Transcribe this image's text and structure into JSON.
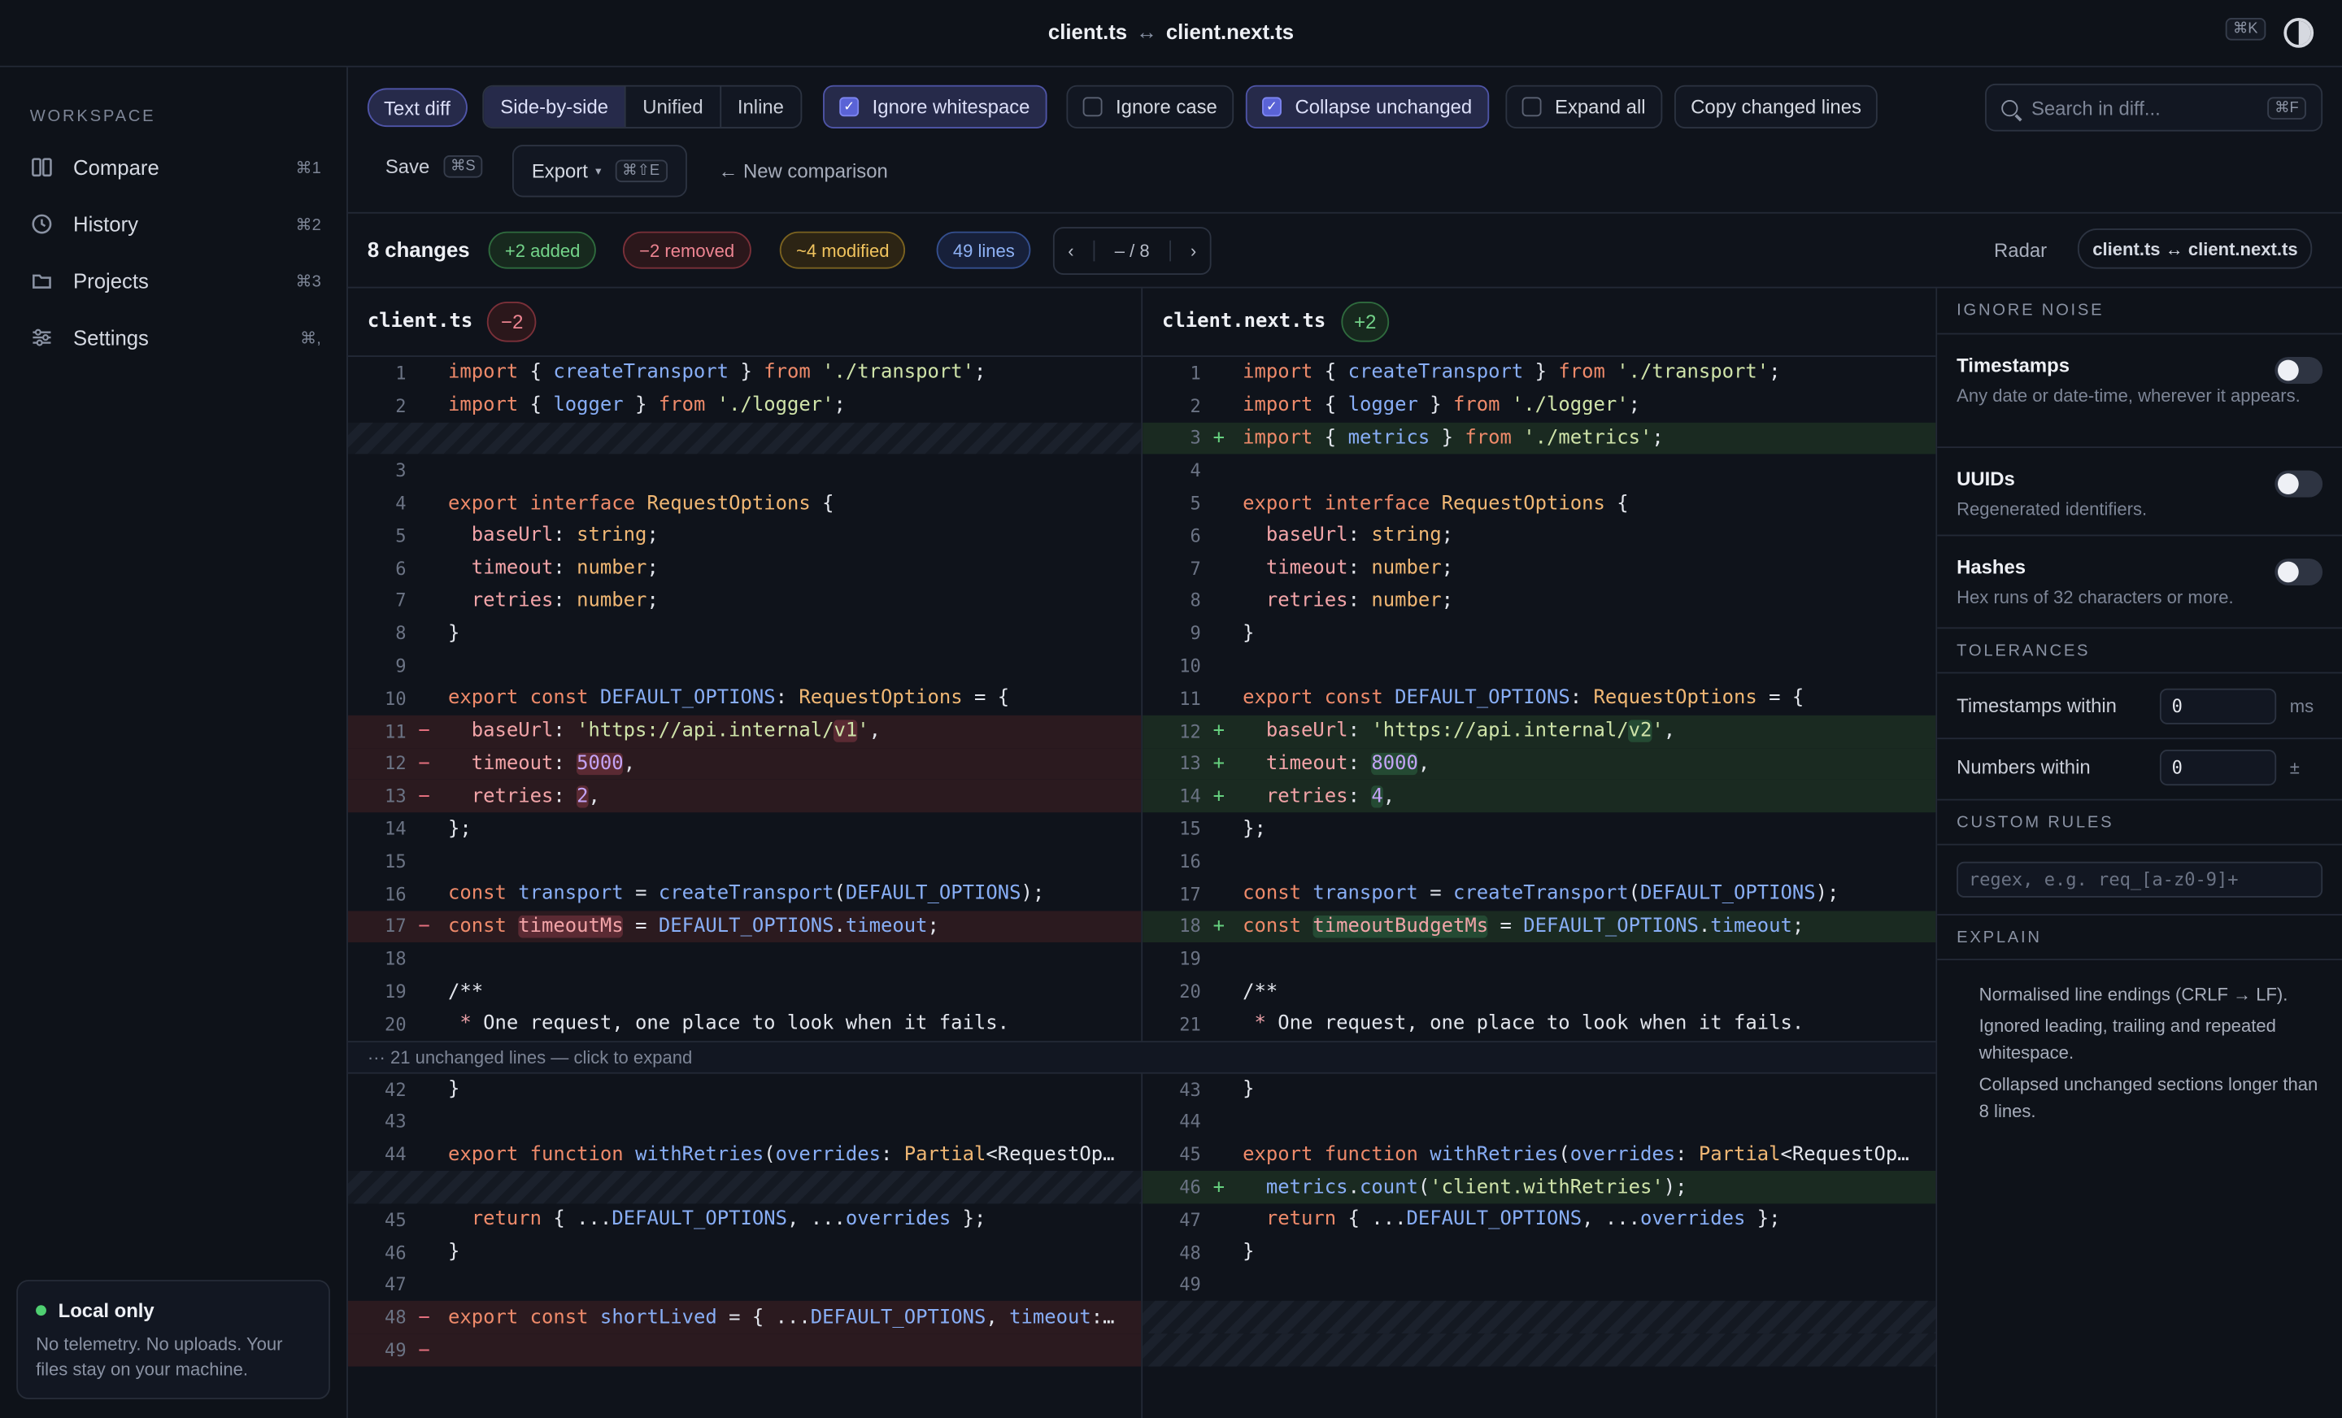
{
  "title": {
    "left_file": "client.ts",
    "arrow": "↔",
    "right_file": "client.next.ts",
    "kbd": "⌘K"
  },
  "sidebar": {
    "section": "WORKSPACE",
    "items": [
      {
        "label": "Compare",
        "shortcut": "⌘1",
        "icon": "columns-icon"
      },
      {
        "label": "History",
        "shortcut": "⌘2",
        "icon": "clock-icon"
      },
      {
        "label": "Projects",
        "shortcut": "⌘3",
        "icon": "folder-icon"
      },
      {
        "label": "Settings",
        "shortcut": "⌘,",
        "icon": "sliders-icon"
      }
    ],
    "local": {
      "title": "Local only",
      "text": "No telemetry. No uploads. Your files stay on your machine."
    }
  },
  "toolbar": {
    "mode": "Text diff",
    "views": [
      "Side-by-side",
      "Unified",
      "Inline"
    ],
    "active_view": "Side-by-side",
    "options": [
      {
        "label": "Ignore whitespace",
        "checked": true
      },
      {
        "label": "Ignore case",
        "checked": false
      },
      {
        "label": "Collapse unchanged",
        "checked": true
      },
      {
        "label": "Expand all",
        "checked": false
      }
    ],
    "copy": "Copy changed lines",
    "search_placeholder": "Search in diff...",
    "search_kbd": "⌘F",
    "save": "Save",
    "save_kbd": "⌘S",
    "export": "Export",
    "export_kbd": "⌘⇧E",
    "new": "← New comparison"
  },
  "summary": {
    "changes": "8 changes",
    "added": "+2 added",
    "removed": "−2 removed",
    "modified": "~4 modified",
    "lines": "49 lines",
    "pager": "– / 8",
    "radar": "Radar",
    "path": "client.ts ↔ client.next.ts"
  },
  "left": {
    "file": "client.ts",
    "count": "−2"
  },
  "right": {
    "file": "client.next.ts",
    "count": "+2"
  },
  "collapsed": "··· 21 unchanged lines — click to expand",
  "panel": {
    "ignore_noise": "IGNORE NOISE",
    "noise": [
      {
        "title": "Timestamps",
        "desc": "Any date or date-time, wherever it appears.",
        "on": false
      },
      {
        "title": "UUIDs",
        "desc": "Regenerated identifiers.",
        "on": false
      },
      {
        "title": "Hashes",
        "desc": "Hex runs of 32 characters or more.",
        "on": false
      }
    ],
    "tolerances": "TOLERANCES",
    "tol": [
      {
        "label": "Timestamps within",
        "value": "0",
        "unit": "ms"
      },
      {
        "label": "Numbers within",
        "value": "0",
        "unit": "±"
      }
    ],
    "custom_rules": "CUSTOM RULES",
    "rule_placeholder": "regex, e.g. req_[a-z0-9]+",
    "explain": "EXPLAIN",
    "explain_items": [
      "Normalised line endings (CRLF → LF).",
      "Ignored leading, trailing and repeated whitespace.",
      "Collapsed unchanged sections longer than 8 lines."
    ]
  },
  "code": {
    "left": [
      {
        "n": "1",
        "t": "",
        "c": "import { createTransport } from './transport';"
      },
      {
        "n": "2",
        "t": "",
        "c": "import { logger } from './logger';"
      },
      {
        "n": "",
        "t": "blank",
        "c": ""
      },
      {
        "n": "3",
        "t": "",
        "c": ""
      },
      {
        "n": "4",
        "t": "",
        "c": "export interface RequestOptions {"
      },
      {
        "n": "5",
        "t": "",
        "c": "  baseUrl: string;"
      },
      {
        "n": "6",
        "t": "",
        "c": "  timeout: number;"
      },
      {
        "n": "7",
        "t": "",
        "c": "  retries: number;"
      },
      {
        "n": "8",
        "t": "",
        "c": "}"
      },
      {
        "n": "9",
        "t": "",
        "c": ""
      },
      {
        "n": "10",
        "t": "",
        "c": "export const DEFAULT_OPTIONS: RequestOptions = {"
      },
      {
        "n": "11",
        "t": "del",
        "c": "  baseUrl: 'https://api.internal/v1',"
      },
      {
        "n": "12",
        "t": "del",
        "c": "  timeout: 5000,"
      },
      {
        "n": "13",
        "t": "del",
        "c": "  retries: 2,"
      },
      {
        "n": "14",
        "t": "",
        "c": "};"
      },
      {
        "n": "15",
        "t": "",
        "c": ""
      },
      {
        "n": "16",
        "t": "",
        "c": "const transport = createTransport(DEFAULT_OPTIONS);"
      },
      {
        "n": "17",
        "t": "del",
        "c": "const timeoutMs = DEFAULT_OPTIONS.timeout;"
      },
      {
        "n": "18",
        "t": "",
        "c": ""
      },
      {
        "n": "19",
        "t": "",
        "c": "/**"
      },
      {
        "n": "20",
        "t": "",
        "c": " * One request, one place to look when it fails."
      },
      {
        "n": "",
        "t": "gap",
        "c": ""
      },
      {
        "n": "42",
        "t": "",
        "c": "}"
      },
      {
        "n": "43",
        "t": "",
        "c": ""
      },
      {
        "n": "44",
        "t": "",
        "c": "export function withRetries(overrides: Partial<RequestOp…"
      },
      {
        "n": "",
        "t": "blank",
        "c": ""
      },
      {
        "n": "45",
        "t": "",
        "c": "  return { ...DEFAULT_OPTIONS, ...overrides };"
      },
      {
        "n": "46",
        "t": "",
        "c": "}"
      },
      {
        "n": "47",
        "t": "",
        "c": ""
      },
      {
        "n": "48",
        "t": "del",
        "c": "export const shortLived = { ...DEFAULT_OPTIONS, timeout:…"
      },
      {
        "n": "49",
        "t": "del",
        "c": ""
      }
    ],
    "right": [
      {
        "n": "1",
        "t": "",
        "c": "import { createTransport } from './transport';"
      },
      {
        "n": "2",
        "t": "",
        "c": "import { logger } from './logger';"
      },
      {
        "n": "3",
        "t": "add",
        "c": "import { metrics } from './metrics';"
      },
      {
        "n": "4",
        "t": "",
        "c": ""
      },
      {
        "n": "5",
        "t": "",
        "c": "export interface RequestOptions {"
      },
      {
        "n": "6",
        "t": "",
        "c": "  baseUrl: string;"
      },
      {
        "n": "7",
        "t": "",
        "c": "  timeout: number;"
      },
      {
        "n": "8",
        "t": "",
        "c": "  retries: number;"
      },
      {
        "n": "9",
        "t": "",
        "c": "}"
      },
      {
        "n": "10",
        "t": "",
        "c": ""
      },
      {
        "n": "11",
        "t": "",
        "c": "export const DEFAULT_OPTIONS: RequestOptions = {"
      },
      {
        "n": "12",
        "t": "add",
        "c": "  baseUrl: 'https://api.internal/v2',"
      },
      {
        "n": "13",
        "t": "add",
        "c": "  timeout: 8000,"
      },
      {
        "n": "14",
        "t": "add",
        "c": "  retries: 4,"
      },
      {
        "n": "15",
        "t": "",
        "c": "};"
      },
      {
        "n": "16",
        "t": "",
        "c": ""
      },
      {
        "n": "17",
        "t": "",
        "c": "const transport = createTransport(DEFAULT_OPTIONS);"
      },
      {
        "n": "18",
        "t": "add",
        "c": "const timeoutBudgetMs = DEFAULT_OPTIONS.timeout;"
      },
      {
        "n": "19",
        "t": "",
        "c": ""
      },
      {
        "n": "20",
        "t": "",
        "c": "/**"
      },
      {
        "n": "21",
        "t": "",
        "c": " * One request, one place to look when it fails."
      },
      {
        "n": "",
        "t": "gap",
        "c": ""
      },
      {
        "n": "43",
        "t": "",
        "c": "}"
      },
      {
        "n": "44",
        "t": "",
        "c": ""
      },
      {
        "n": "45",
        "t": "",
        "c": "export function withRetries(overrides: Partial<RequestOp…"
      },
      {
        "n": "46",
        "t": "add",
        "c": "  metrics.count('client.withRetries');"
      },
      {
        "n": "47",
        "t": "",
        "c": "  return { ...DEFAULT_OPTIONS, ...overrides };"
      },
      {
        "n": "48",
        "t": "",
        "c": "}"
      },
      {
        "n": "49",
        "t": "",
        "c": ""
      },
      {
        "n": "",
        "t": "blank",
        "c": ""
      },
      {
        "n": "",
        "t": "blank",
        "c": ""
      }
    ]
  }
}
